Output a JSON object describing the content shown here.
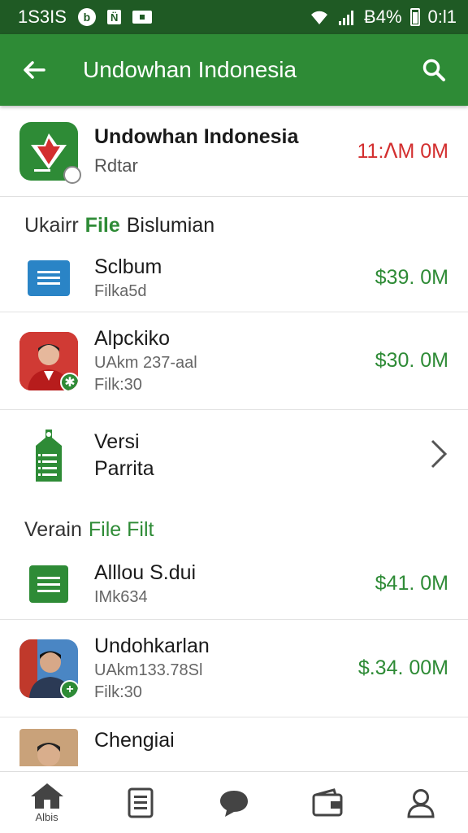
{
  "status_bar": {
    "time_left": "1S3IS",
    "battery": "Ƀ4%",
    "time_right": "0:Ɩ1"
  },
  "app_bar": {
    "title": "Undowhan Indonesia"
  },
  "header_card": {
    "name": "Undowhan Indonesia",
    "sub": "Rdtar",
    "amount": "11:ᐱM 0M",
    "amount_color": "#d32f2f"
  },
  "section1": {
    "prefix": "Ukairr",
    "green": "File",
    "suffix": "Bislumian"
  },
  "rows1": [
    {
      "title": "Sclbum",
      "sub1": "Filka5d",
      "amount": "$39. 0M"
    },
    {
      "title": "Alpckiko",
      "sub1": "UAkm 237-aal",
      "sub2": "Filk:30",
      "amount": "$30. 0M"
    },
    {
      "title": "Versi",
      "sub1": "Parrita"
    }
  ],
  "section2": {
    "prefix": "Verain",
    "green": "File Filt"
  },
  "rows2": [
    {
      "title": "Alllou S.dui",
      "sub1": "IMk634",
      "amount": "$41. 0M"
    },
    {
      "title": "Undohkarlan",
      "sub1": "UAkm133.78Sl",
      "sub2": "Filk:30",
      "amount": "$.34. 00M"
    },
    {
      "title": "Chengiai"
    }
  ],
  "bottom_nav": {
    "home_label": "Albis"
  },
  "colors": {
    "primary": "#2e8b36",
    "status_bar": "#1f5a24",
    "negative": "#d32f2f"
  }
}
